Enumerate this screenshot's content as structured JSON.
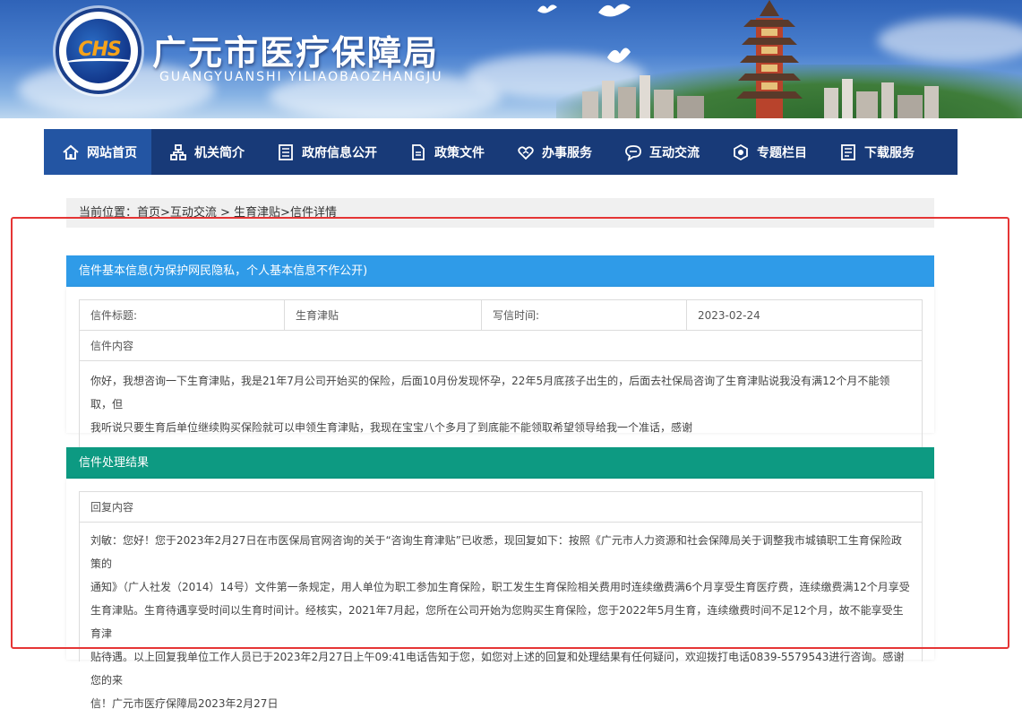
{
  "header": {
    "logo_text": "CHS",
    "title": "广元市医疗保障局",
    "subtitle": "GUANGYUANSHI YILIAOBAOZHANGJU"
  },
  "nav": {
    "items": [
      {
        "label": "网站首页",
        "icon": "home-icon"
      },
      {
        "label": "机关简介",
        "icon": "org-chart-icon"
      },
      {
        "label": "政府信息公开",
        "icon": "document-list-icon"
      },
      {
        "label": "政策文件",
        "icon": "file-icon"
      },
      {
        "label": "办事服务",
        "icon": "service-icon"
      },
      {
        "label": "互动交流",
        "icon": "chat-bubble-icon"
      },
      {
        "label": "专题栏目",
        "icon": "topic-icon"
      },
      {
        "label": "下载服务",
        "icon": "download-doc-icon"
      }
    ]
  },
  "breadcrumb": "当前位置：首页>互动交流 > 生育津贴>信件详情",
  "letter_info": {
    "heading": "信件基本信息(为保护网民隐私，个人基本信息不作公开)",
    "title_label": "信件标题:",
    "title_value": "生育津贴",
    "date_label": "写信时间:",
    "date_value": "2023-02-24",
    "content_label": "信件内容",
    "content_line1": "你好，我想咨询一下生育津贴，我是21年7月公司开始买的保险，后面10月份发现怀孕，22年5月底孩子出生的，后面去社保局咨询了生育津贴说我没有满12个月不能领取，但",
    "content_line2": "我听说只要生育后单位继续购买保险就可以申领生育津贴，我现在宝宝八个多月了到底能不能领取希望领导给我一个准话，感谢"
  },
  "result": {
    "heading": "信件处理结果",
    "reply_label": "回复内容",
    "reply_line1": "刘敏：您好！您于2023年2月27日在市医保局官网咨询的关于“咨询生育津贴”已收悉，现回复如下：按照《广元市人力资源和社会保障局关于调整我市城镇职工生育保险政策的",
    "reply_line2": "通知》（广人社发（2014）14号）文件第一条规定，用人单位为职工参加生育保险，职工发生生育保险相关费用时连续缴费满6个月享受生育医疗费，连续缴费满12个月享受",
    "reply_line3": "生育津贴。生育待遇享受时间以生育时间计。经核实，2021年7月起，您所在公司开始为您购买生育保险，您于2022年5月生育，连续缴费时间不足12个月，故不能享受生育津",
    "reply_line4": "贴待遇。以上回复我单位工作人员已于2023年2月27日上午09:41电话告知于您，如您对上述的回复和处理结果有任何疑问，欢迎拨打电话0839-5579543进行咨询。感谢您的来",
    "reply_line5": "信！广元市医疗保障局2023年2月27日"
  },
  "colors": {
    "nav_bg": "#183a78",
    "nav_active": "#2355a3",
    "panel_blue": "#2f9be8",
    "panel_green": "#0d9a82",
    "highlight_red": "#e53535"
  }
}
